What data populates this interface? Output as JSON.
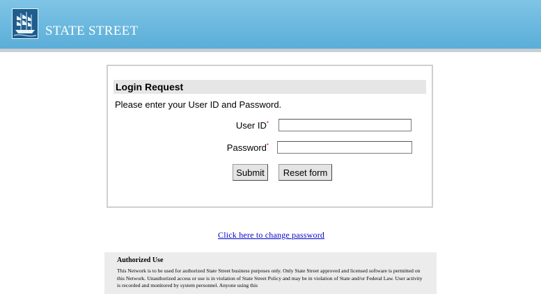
{
  "header": {
    "brand_name": "STATE STREET",
    "logo_icon": "sailing-ship-icon",
    "colors": {
      "band_top": "#7fc4e6",
      "band_bottom": "#5aaed8",
      "logo_bg": "#1f5d8e"
    }
  },
  "login": {
    "title": "Login Request",
    "instructions": "Please enter your User ID and Password.",
    "user_label": "User ID",
    "password_label": "Password",
    "required_marker": "*",
    "user_value": "",
    "password_value": "",
    "submit_label": "Submit",
    "reset_label": "Reset form"
  },
  "links": {
    "change_password": "Click here to change password"
  },
  "authorized_use": {
    "title": "Authorized Use",
    "text": "This Network is to be used for authorized State Street business purposes only. Only State Street approved and licensed software is permitted on this Network. Unauthorized access or use is in violation of State Street Policy and may be in violation of State and/or Federal Law. User activity is recorded and monitored by system personnel. Anyone using this"
  }
}
